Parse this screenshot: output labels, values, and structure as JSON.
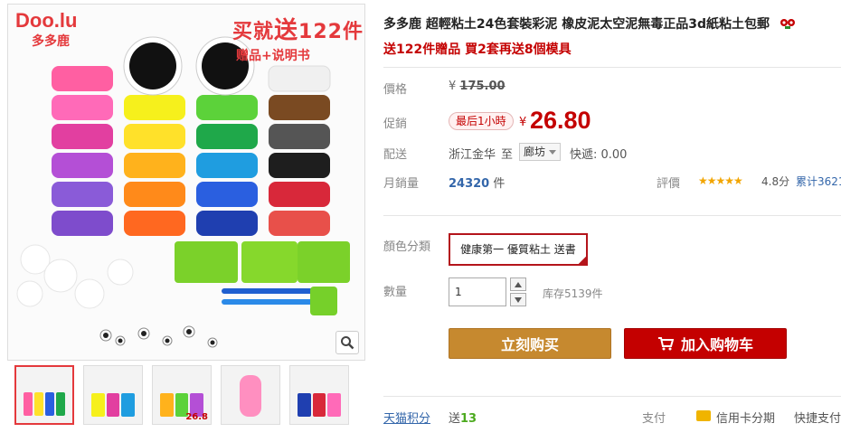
{
  "gallery": {
    "brand_text": "Doo.lu",
    "brand_cn": "多多鹿",
    "banner_prefix": "买就",
    "banner_gift": "送",
    "banner_count": "122件",
    "banner_sub": "赠品+说明书",
    "icons": [
      "zoom-icon"
    ]
  },
  "thumbnails": [
    {
      "label": "",
      "active": true
    },
    {
      "label": "",
      "active": false
    },
    {
      "label": "26.8",
      "active": false
    },
    {
      "label": "",
      "active": false
    },
    {
      "label": "",
      "active": false
    }
  ],
  "product": {
    "title": "多多鹿 超輕粘土24色套裝彩泥 橡皮泥太空泥無毒正品3d紙粘土包郵",
    "subtitle": "送122件贈品 買2套再送8個模具"
  },
  "price": {
    "label": "價格",
    "currency": "¥",
    "original": "175.00",
    "promo_label": "促銷",
    "promo_tag": "最后1小時",
    "current": "26.80"
  },
  "shipping": {
    "label": "配送",
    "from": "浙江金华",
    "to_word": "至",
    "to_city": "廊坊",
    "express": "快遞: 0.00"
  },
  "sales": {
    "label": "月銷量",
    "count": "24320",
    "unit": "件",
    "review_label": "評價",
    "stars": "★★★★★",
    "score": "4.8分",
    "cumulative": "累计3621"
  },
  "sku": {
    "label": "顏色分類",
    "selected": "健康第一 優質粘土 送書"
  },
  "quantity": {
    "label": "數量",
    "value": "1",
    "stock": "库存5139件"
  },
  "buttons": {
    "buy_now": "立刻购买",
    "add_cart": "加入购物车"
  },
  "bottom": {
    "points_label": "天猫积分",
    "points_prefix": "送",
    "points_value": "13",
    "pay_label": "支付",
    "credit": "信用卡分期",
    "fast_pay": "快捷支付"
  },
  "colors": {
    "accent": "#c40000",
    "buy_button": "#c6892f",
    "cart_button": "#c40000",
    "star": "#f2a500",
    "link": "#3366aa"
  }
}
